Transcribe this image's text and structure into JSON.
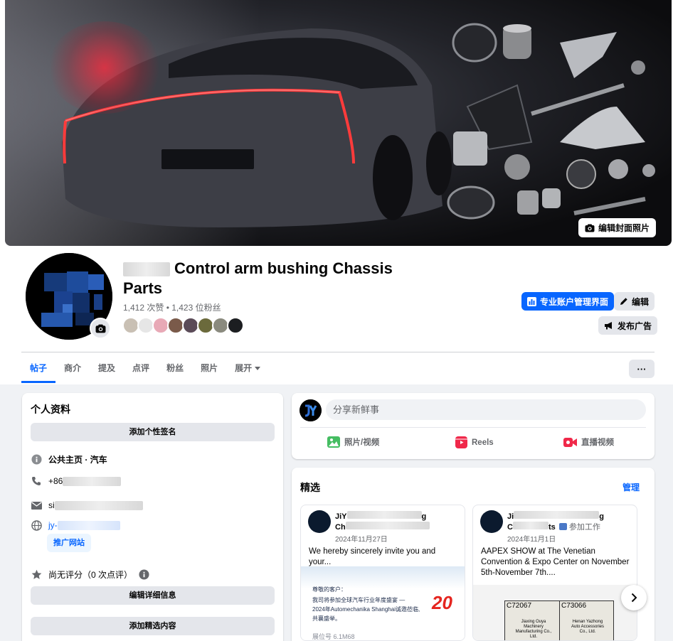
{
  "cover": {
    "edit_label": "编辑封面照片"
  },
  "profile": {
    "title": "Control arm bushing Chassis Parts",
    "stats": "1,412 次赞 • 1,423 位粉丝"
  },
  "actions": {
    "professional_dashboard": "专业账户管理界面",
    "edit": "编辑",
    "advertise": "发布广告",
    "more": "···"
  },
  "tabs": [
    {
      "label": "帖子"
    },
    {
      "label": "商介"
    },
    {
      "label": "提及"
    },
    {
      "label": "点评"
    },
    {
      "label": "粉丝"
    },
    {
      "label": "照片"
    },
    {
      "label": "展开"
    }
  ],
  "intro": {
    "title": "个人资料",
    "add_bio": "添加个性签名",
    "category": "公共主页 · 汽车",
    "phone_prefix": "+86",
    "email_prefix": "si",
    "website_prefix": "jy-",
    "promote_website": "推广网站",
    "rating": "尚无评分（0 次点评）",
    "edit_details": "编辑详细信息",
    "add_featured": "添加精选内容"
  },
  "composer": {
    "placeholder": "分享新鲜事",
    "photo_video": "照片/视频",
    "reels": "Reels",
    "live": "直播视频"
  },
  "featured": {
    "title": "精选",
    "manage": "管理",
    "posts": [
      {
        "author_prefix": "JiY",
        "author_suffix": "g",
        "author_line2": "Ch",
        "date": "2024年11月27日",
        "text": "We hereby sincerely invite you and your...",
        "image_text_1": "尊敬的客户：",
        "image_text_2": "我司将参加全球汽车行业年度盛宴 —",
        "image_text_3": "2024年Automechanika Shanghai诚邀莅临,",
        "image_text_4": "共襄盛举。",
        "image_text_5": "展位号   6.1M68",
        "badge": "20"
      },
      {
        "author_prefix": "Ji",
        "author_suffix": "g",
        "author_line2": "C",
        "author_line2_suffix": "ts",
        "work_tag": "参加工作",
        "date": "2024年11月1日",
        "text": "AAPEX SHOW at The Venetian Convention & Expo Center on November 5th-November 7th....",
        "booth_1": "C72067",
        "booth_2": "C73066",
        "company_1": "Jiaxing Ouya Machinery Manufacturing Co., Ltd.",
        "company_2": "Henan Yazhong Auto Accessories Co., Ltd."
      }
    ]
  }
}
